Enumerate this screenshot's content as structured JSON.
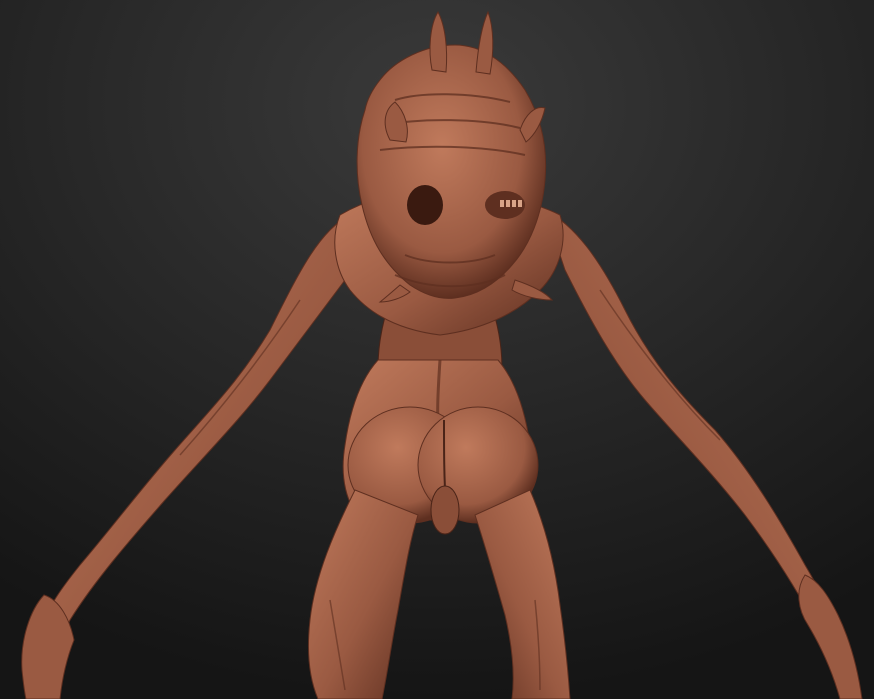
{
  "scene": {
    "subject": "sculpt-render-creature-back-view",
    "colors": {
      "background_top": "#3a3a3a",
      "background_bottom": "#151515",
      "clay_highlight": "#c07a5c",
      "clay_mid": "#9a5a42",
      "clay_shadow": "#5e2f20",
      "clay_deep": "#3a1a10"
    }
  }
}
